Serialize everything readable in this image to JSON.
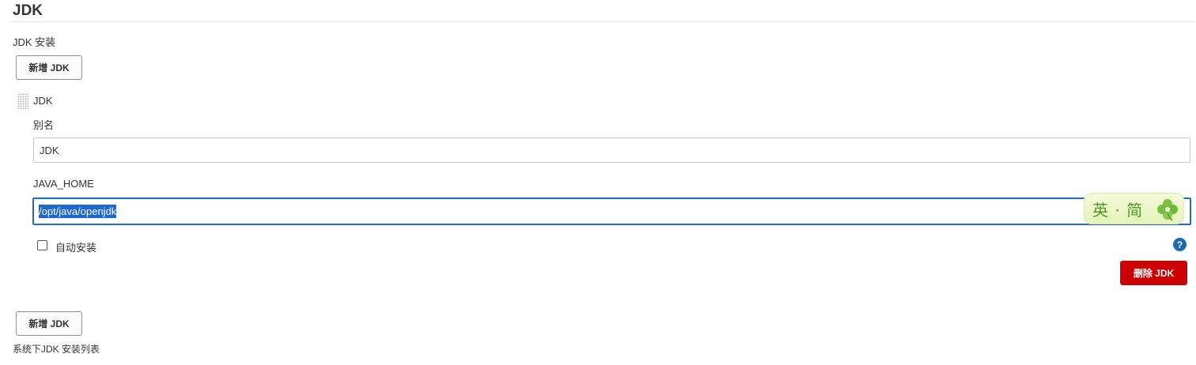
{
  "section": {
    "title": "JDK",
    "installations_label": "JDK 安装",
    "description": "系统下JDK 安装列表"
  },
  "buttons": {
    "add_jdk": "新增 JDK",
    "delete_jdk": "删除 JDK"
  },
  "jdk_item": {
    "title": "JDK",
    "alias_label": "别名",
    "alias_value": "JDK",
    "java_home_label": "JAVA_HOME",
    "java_home_value": "/opt/java/openjdk",
    "auto_install_label": "自动安装",
    "auto_install_checked": false
  },
  "ime_indicator": {
    "text": "英 · 简"
  },
  "icons": {
    "help": "help-icon",
    "drag": "drag-handle-icon",
    "ime_logo": "clover-icon"
  },
  "colors": {
    "delete_button": "#cc0000",
    "focus_border": "#1d6dc9",
    "help_icon": "#1a6bb0"
  }
}
